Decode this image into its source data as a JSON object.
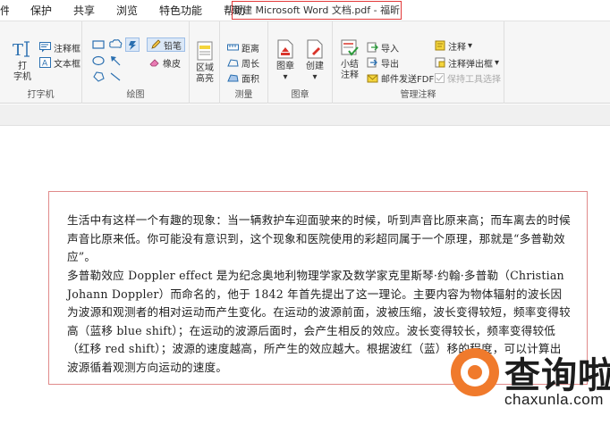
{
  "menu": {
    "items": [
      "件",
      "保护",
      "共享",
      "浏览",
      "特色功能",
      "帮助"
    ]
  },
  "window": {
    "title": "新建 Microsoft Word 文档.pdf - 福昕阅读器"
  },
  "ribbon": {
    "typewriter": {
      "typewriter_label_1": "打",
      "typewriter_label_2": "字机",
      "comment_box": "注释框",
      "text_box": "文本框",
      "group": "打字机"
    },
    "drawing": {
      "pencil": "铅笔",
      "eraser": "橡皮",
      "group": "绘图"
    },
    "region": {
      "label_1": "区域",
      "label_2": "高亮"
    },
    "measure": {
      "distance": "距离",
      "perimeter": "周长",
      "area": "面积",
      "group": "测量"
    },
    "image": {
      "image": "图章",
      "create": "创建",
      "group": "图章"
    },
    "summary": {
      "label_1": "小结",
      "label_2": "注释"
    },
    "manage": {
      "import": "导入",
      "export": "导出",
      "email": "邮件发送FDF",
      "annotations": "注释",
      "popup": "注释弹出框",
      "keep_tool": "保持工具选择",
      "group": "管理注释"
    }
  },
  "document": {
    "paragraphs": [
      "生活中有这样一个有趣的现象：当一辆救护车迎面驶来的时候，听到声音比原来高；而车离去的时候声音比原来低。你可能没有意识到，这个现象和医院使用的彩超同属于一个原理，那就是“多普勒效应”。",
      "多普勒效应 Doppler effect 是为纪念奥地利物理学家及数学家克里斯琴·约翰·多普勒（Christian Johann Doppler）而命名的，他于 1842 年首先提出了这一理论。主要内容为物体辐射的波长因为波源和观测者的相对运动而产生变化。在运动的波源前面，波被压缩，波长变得较短，频率变得较高（蓝移 blue shift）；在运动的波源后面时，会产生相反的效应。波长变得较长，频率变得较低（红移 red shift）；波源的速度越高，所产生的效应越大。根据波红（蓝）移的程度，可以计算出波源循着观测方向运动的速度。"
    ]
  },
  "watermark": {
    "cn": "查询啦",
    "en": "chaxunla.com"
  },
  "colors": {
    "accent": "#f07a2c",
    "title_border": "#e23a3a",
    "textbox_border": "#e08a8a"
  }
}
